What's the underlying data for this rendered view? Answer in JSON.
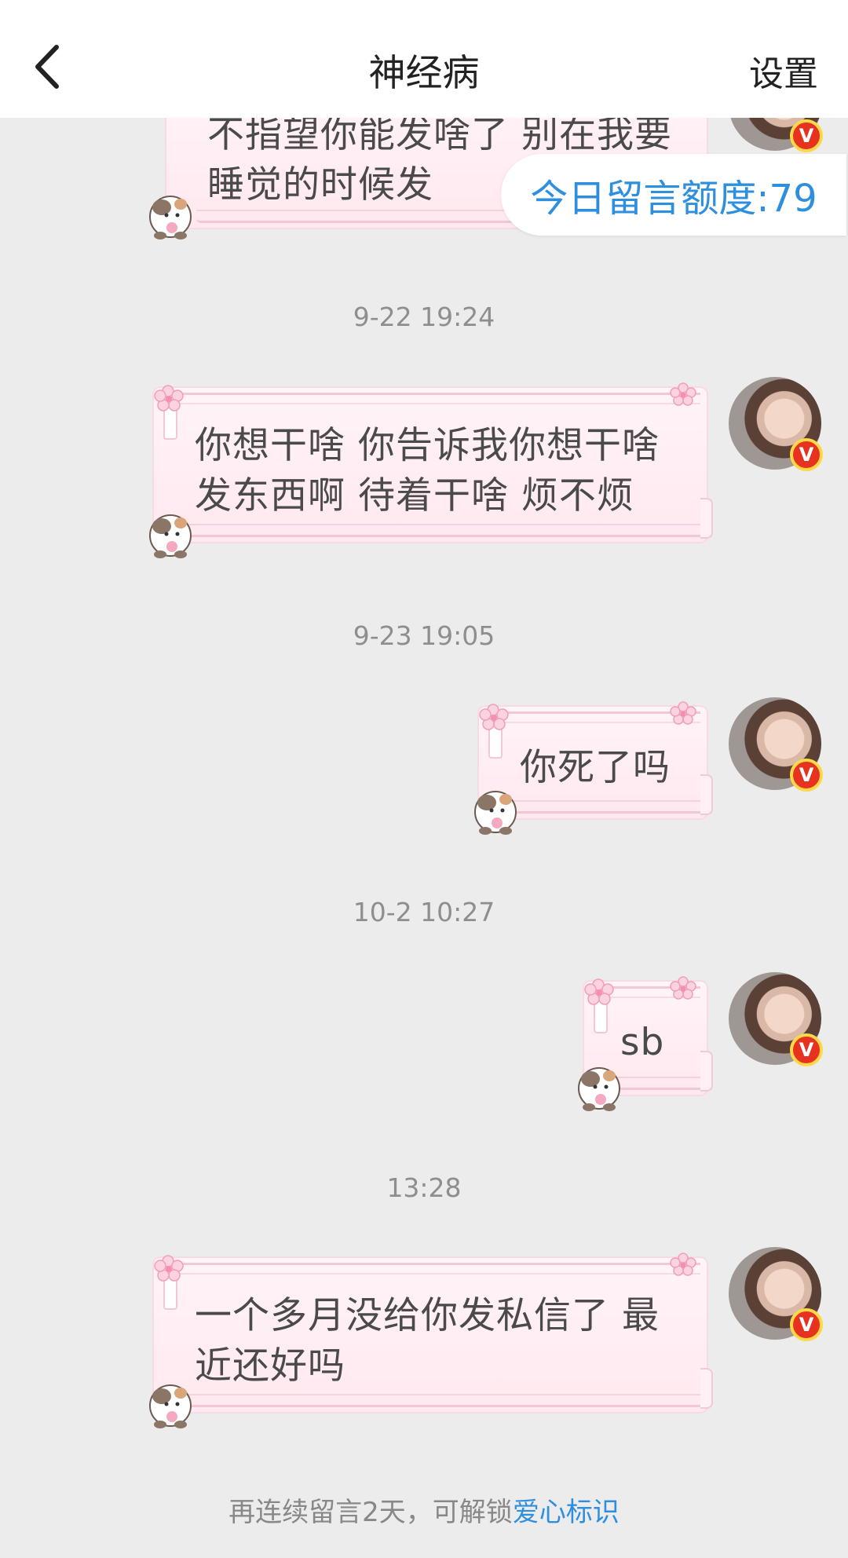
{
  "header": {
    "title": "神经病",
    "settings_label": "设置"
  },
  "quota": {
    "label": "今日留言额度:79"
  },
  "messages": [
    {
      "text": "不指望你能发啥了 别在我要\n睡觉的时候发"
    },
    {
      "time": "9-22 19:24",
      "text": "你想干啥 你告诉我你想干啥\n发东西啊 待着干啥 烦不烦"
    },
    {
      "time": "9-23 19:05",
      "text": "你死了吗"
    },
    {
      "time": "10-2 10:27",
      "text": "sb"
    },
    {
      "time": "13:28",
      "text": "一个多月没给你发私信了 最\n近还好吗"
    }
  ],
  "footer": {
    "prefix": "再连续留言2天，可解锁",
    "link": "爱心标识"
  },
  "colors": {
    "accent": "#2f8fdf",
    "bubble_bg": "#fff0f5",
    "page_bg": "#ececec",
    "badge": "#e6321e"
  }
}
